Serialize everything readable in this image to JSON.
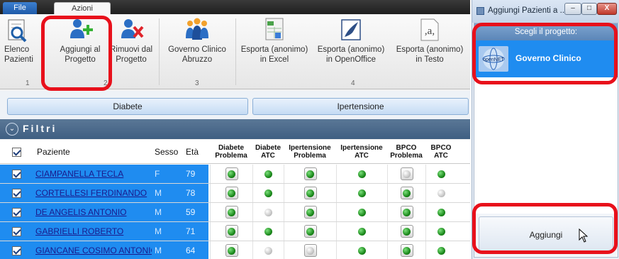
{
  "app": {
    "tabs": {
      "file": "File",
      "azioni": "Azioni"
    },
    "ribbon": {
      "buttons": [
        {
          "label1": "Elenco",
          "label2": "Pazienti",
          "icon": "search-list-icon"
        },
        {
          "label1": "Aggiungi al",
          "label2": "Progetto",
          "icon": "add-users-icon"
        },
        {
          "label1": "Rimuovi dal",
          "label2": "Progetto",
          "icon": "remove-users-icon"
        },
        {
          "label1": "Governo Clinico",
          "label2": "Abruzzo",
          "icon": "group-icon"
        },
        {
          "label1": "Esporta (anonimo)",
          "label2": "in Excel",
          "icon": "excel-icon"
        },
        {
          "label1": "Esporta (anonimo)",
          "label2": "in OpenOffice",
          "icon": "openoffice-icon"
        },
        {
          "label1": "Esporta (anonimo)",
          "label2": "in Testo",
          "icon": "text-icon"
        }
      ],
      "groups": [
        "1",
        "2",
        "3",
        "4"
      ]
    },
    "filter_tabs": [
      "Diabete",
      "Ipertensione"
    ],
    "filtri_label": "Filtri",
    "grid": {
      "columns": [
        "Paziente",
        "Sesso",
        "Età",
        "Diabete Problema",
        "Diabete ATC",
        "Ipertensione Problema",
        "Ipertensione ATC",
        "BPCO Problema",
        "BPCO ATC"
      ],
      "rows": [
        {
          "name": "CIAMPANELLA TECLA",
          "sex": "F",
          "age": "79",
          "checked": true,
          "ind": [
            "g",
            "g",
            "g",
            "g",
            "n",
            "g"
          ]
        },
        {
          "name": "CORTELLESI FERDINANDO",
          "sex": "M",
          "age": "78",
          "checked": true,
          "ind": [
            "g",
            "g",
            "g",
            "g",
            "g",
            "n"
          ]
        },
        {
          "name": "DE ANGELIS ANTONIO",
          "sex": "M",
          "age": "59",
          "checked": true,
          "ind": [
            "g",
            "n",
            "g",
            "g",
            "g",
            "g"
          ]
        },
        {
          "name": "GABRIELLI ROBERTO",
          "sex": "M",
          "age": "71",
          "checked": true,
          "ind": [
            "g",
            "g",
            "g",
            "g",
            "g",
            "g"
          ]
        },
        {
          "name": "GIANCANE COSIMO ANTONIO",
          "sex": "M",
          "age": "64",
          "checked": true,
          "ind": [
            "g",
            "n",
            "n",
            "g",
            "g",
            "g"
          ]
        }
      ]
    }
  },
  "dialog": {
    "title": "Aggiungi Pazienti a ...",
    "header": "Scegli il progetto:",
    "project": {
      "name": "Governo Clinico",
      "logo_text": "openNET"
    },
    "add_button": "Aggiungi",
    "window_buttons": {
      "minimize": "–",
      "maximize": "□",
      "close": "X"
    }
  },
  "colors": {
    "selection": "#1f8cf0",
    "highlight": "#e8101b"
  }
}
